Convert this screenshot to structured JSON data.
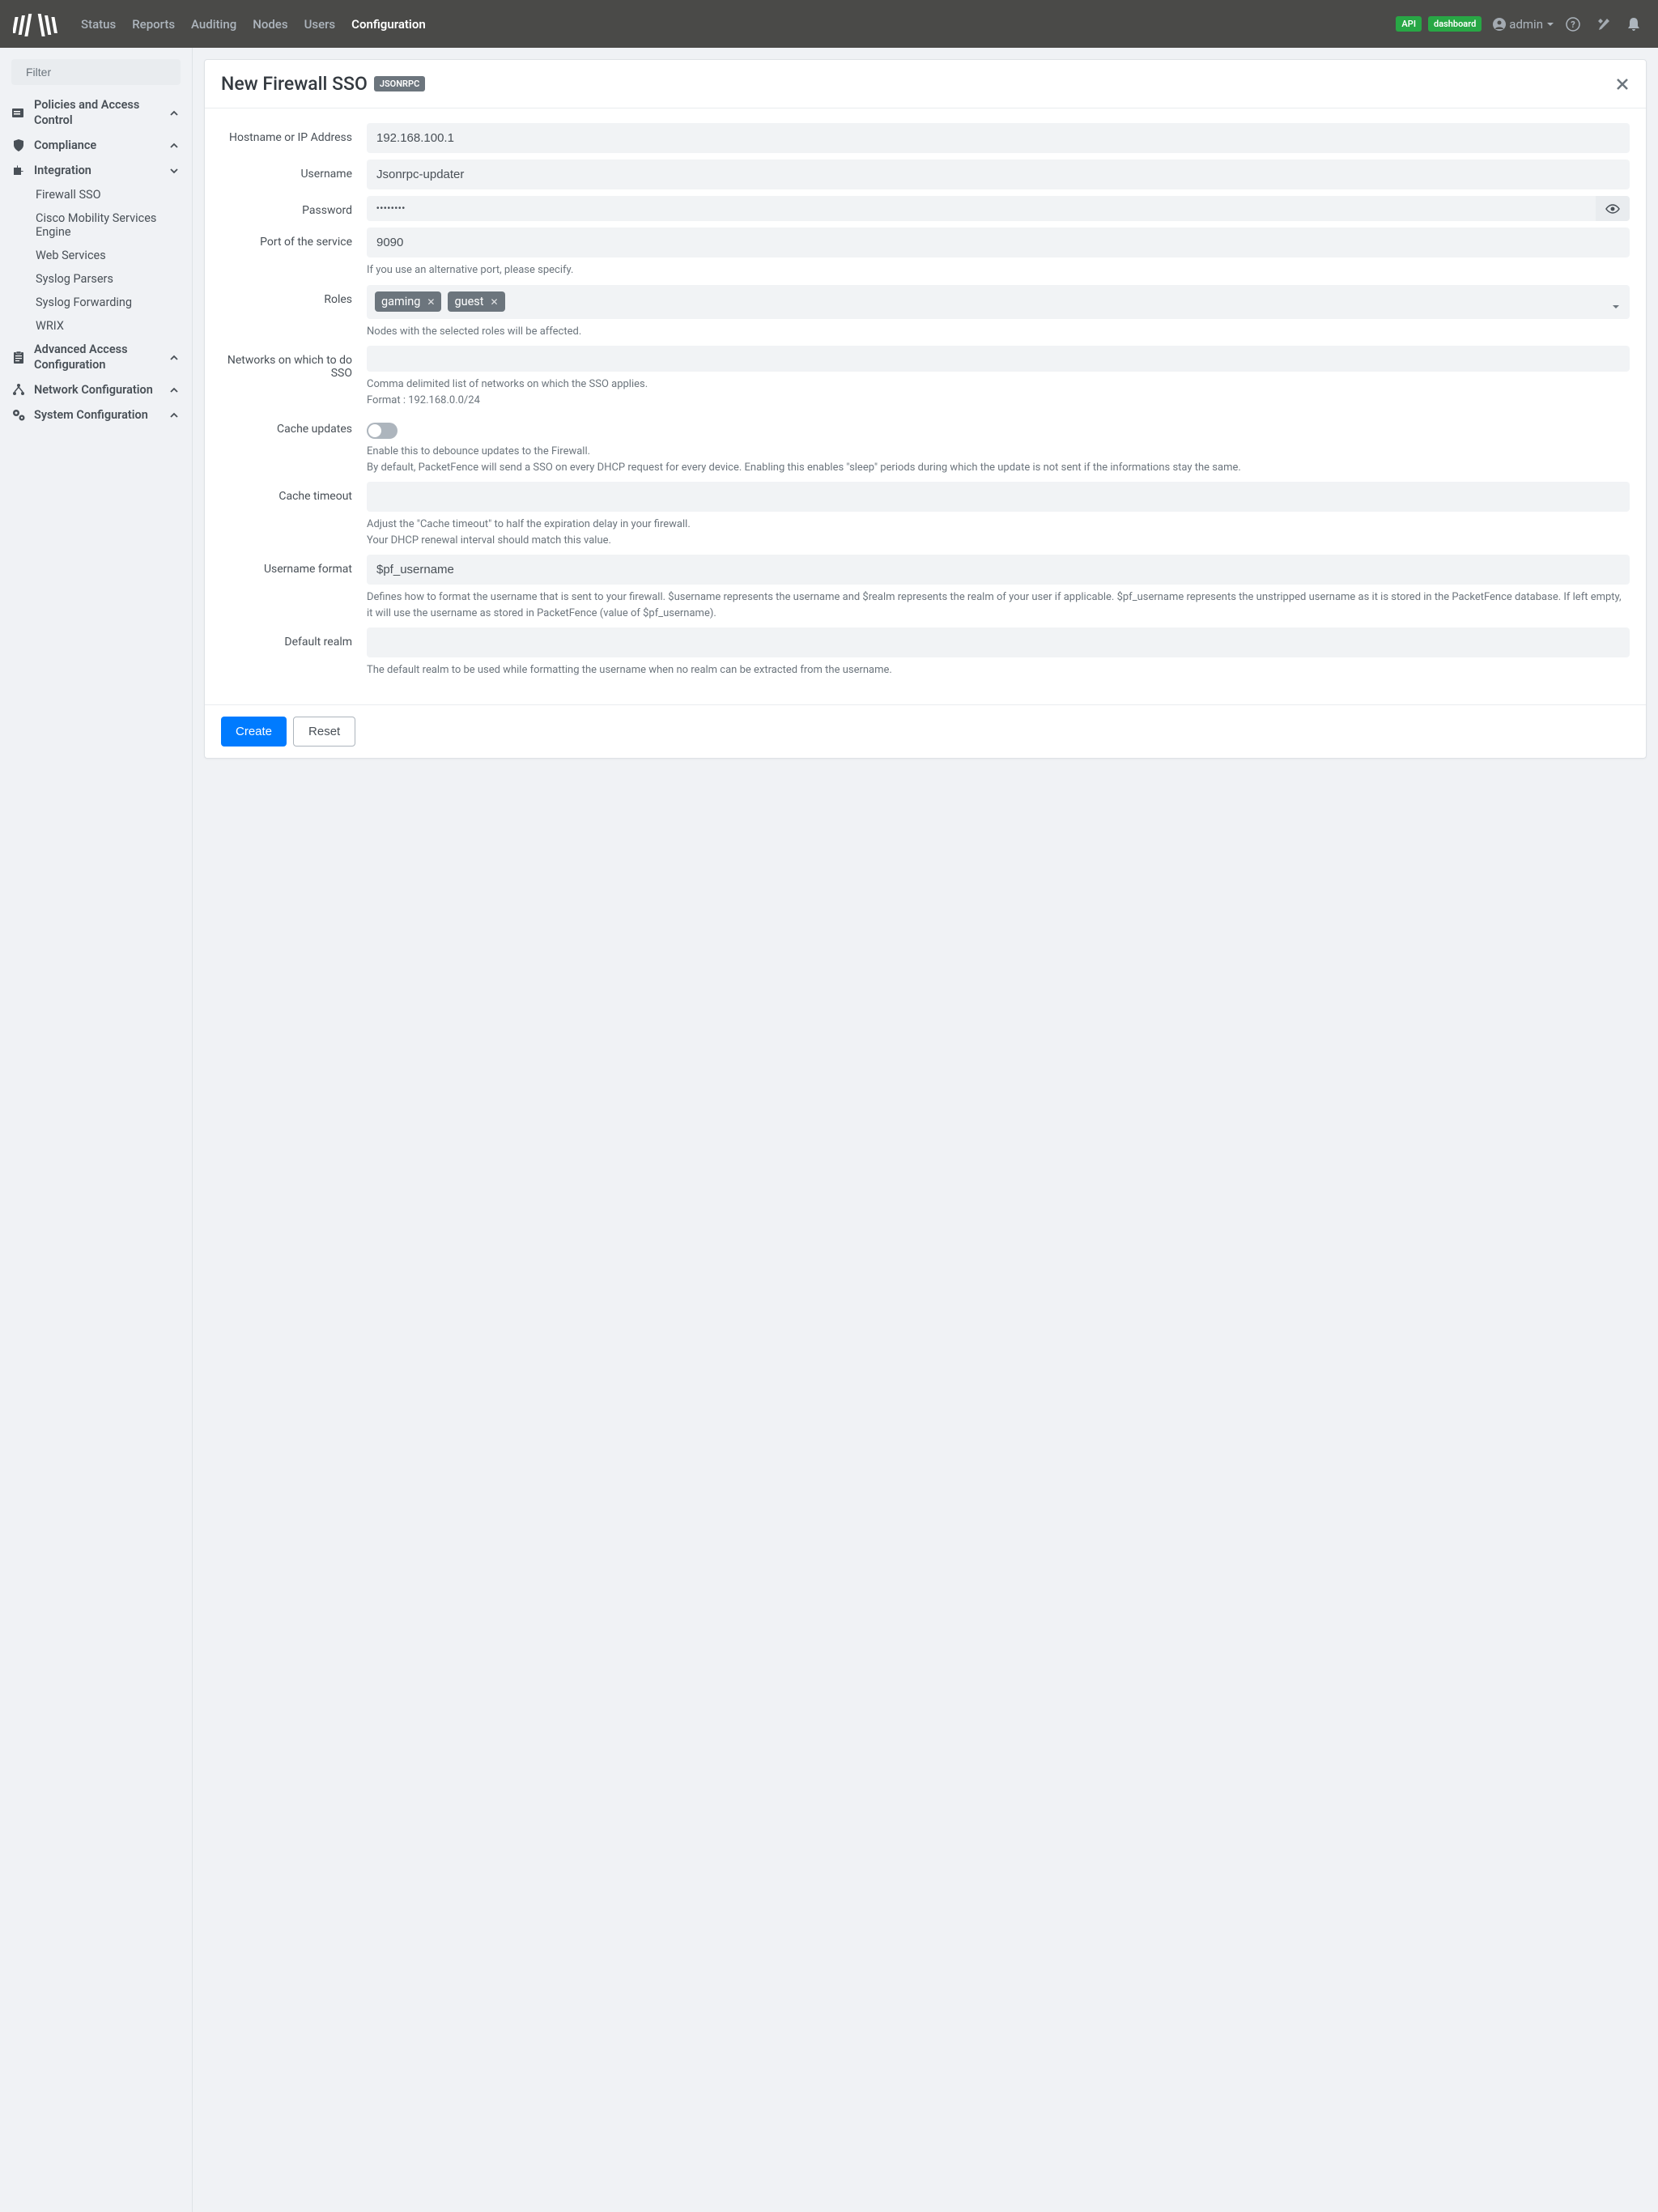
{
  "nav": {
    "items": [
      "Status",
      "Reports",
      "Auditing",
      "Nodes",
      "Users",
      "Configuration"
    ],
    "active": "Configuration",
    "badges": {
      "api": "API",
      "dashboard": "dashboard"
    },
    "user": "admin"
  },
  "sidebar": {
    "filter_placeholder": "Filter",
    "sections": [
      {
        "label": "Policies and Access Control"
      },
      {
        "label": "Compliance"
      },
      {
        "label": "Integration",
        "expanded": true,
        "items": [
          "Firewall SSO",
          "Cisco Mobility Services Engine",
          "Web Services",
          "Syslog Parsers",
          "Syslog Forwarding",
          "WRIX"
        ]
      },
      {
        "label": "Advanced Access Configuration"
      },
      {
        "label": "Network Configuration"
      },
      {
        "label": "System Configuration"
      }
    ]
  },
  "page": {
    "title": "New Firewall SSO",
    "method_badge": "JSONRPC",
    "form": {
      "hostname": {
        "label": "Hostname or IP Address",
        "value": "192.168.100.1"
      },
      "username": {
        "label": "Username",
        "value": "Jsonrpc-updater"
      },
      "password": {
        "label": "Password",
        "value": "••••••••"
      },
      "port": {
        "label": "Port of the service",
        "value": "9090",
        "help": "If you use an alternative port, please specify."
      },
      "roles": {
        "label": "Roles",
        "chips": [
          "gaming",
          "guest"
        ],
        "help": "Nodes with the selected roles will be affected."
      },
      "networks": {
        "label": "Networks on which to do SSO",
        "value": "",
        "help": "Comma delimited list of networks on which the SSO applies.\nFormat : 192.168.0.0/24"
      },
      "cache_updates": {
        "label": "Cache updates",
        "on": false,
        "help": "Enable this to debounce updates to the Firewall.\nBy default, PacketFence will send a SSO on every DHCP request for every device. Enabling this enables \"sleep\" periods during which the update is not sent if the informations stay the same."
      },
      "cache_timeout": {
        "label": "Cache timeout",
        "value": "",
        "help": "Adjust the \"Cache timeout\" to half the expiration delay in your firewall.\nYour DHCP renewal interval should match this value."
      },
      "username_format": {
        "label": "Username format",
        "value": "$pf_username",
        "help": "Defines how to format the username that is sent to your firewall. $username represents the username and $realm represents the realm of your user if applicable. $pf_username represents the unstripped username as it is stored in the PacketFence database. If left empty, it will use the username as stored in PacketFence (value of $pf_username)."
      },
      "default_realm": {
        "label": "Default realm",
        "value": "",
        "help": "The default realm to be used while formatting the username when no realm can be extracted from the username."
      }
    },
    "buttons": {
      "create": "Create",
      "reset": "Reset"
    }
  }
}
